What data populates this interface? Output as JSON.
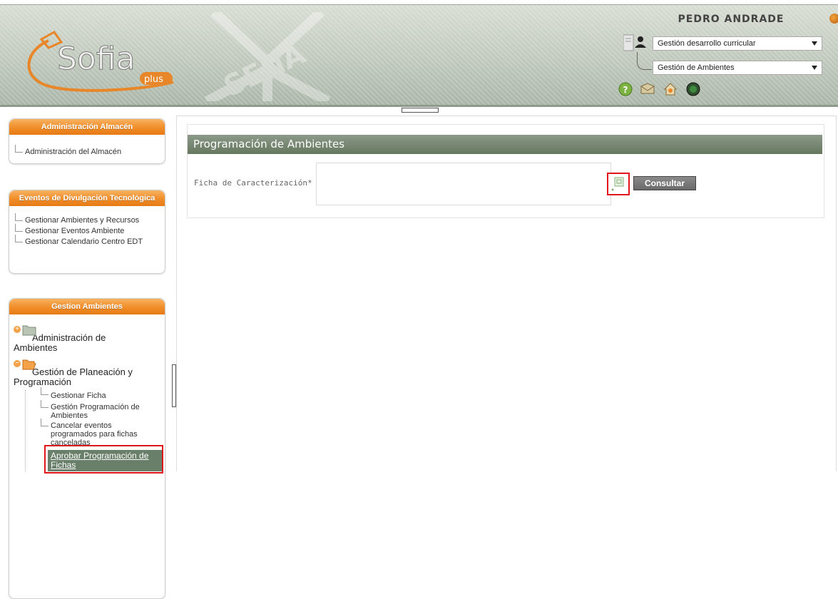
{
  "header": {
    "logo_text": "Sofia",
    "logo_sub": "plus",
    "watermark": "SENA",
    "user_name": "PEDRO ANDRADE",
    "role_select": {
      "value": "Gestión desarrollo curricular"
    },
    "module_select": {
      "value": "Gestión de Ambientes"
    },
    "icons": [
      "help-icon",
      "mail-icon",
      "home-icon",
      "logout-icon"
    ]
  },
  "sidebar": {
    "panels": [
      {
        "title": "Administración Almacén",
        "items": [
          "Administración del Almacén"
        ]
      },
      {
        "title": "Eventos de Divulgación Tecnológica",
        "items": [
          "Gestionar Ambientes y Recursos",
          "Gestionar Eventos Ambiente",
          "Gestionar Calendario Centro EDT"
        ]
      },
      {
        "title": "Gestion Ambientes",
        "folders": [
          {
            "label": "Administración de Ambientes",
            "expanded": false
          },
          {
            "label": "Gestión de Planeación y Programación",
            "expanded": true,
            "items": [
              "Gestionar Ficha",
              "Gestión Programación de Ambientes",
              "Cancelar eventos programados para fichas canceladas",
              "Aprobar Programación de Fichas"
            ]
          }
        ]
      }
    ]
  },
  "main": {
    "section_title": "Programación de Ambientes",
    "field_label": "Ficha de Caracterización*",
    "field_value": "",
    "consultar_label": "Consultar"
  },
  "colors": {
    "accent_orange": "#f08d28",
    "section_green": "#75856f",
    "highlight_red": "#e0151b"
  }
}
